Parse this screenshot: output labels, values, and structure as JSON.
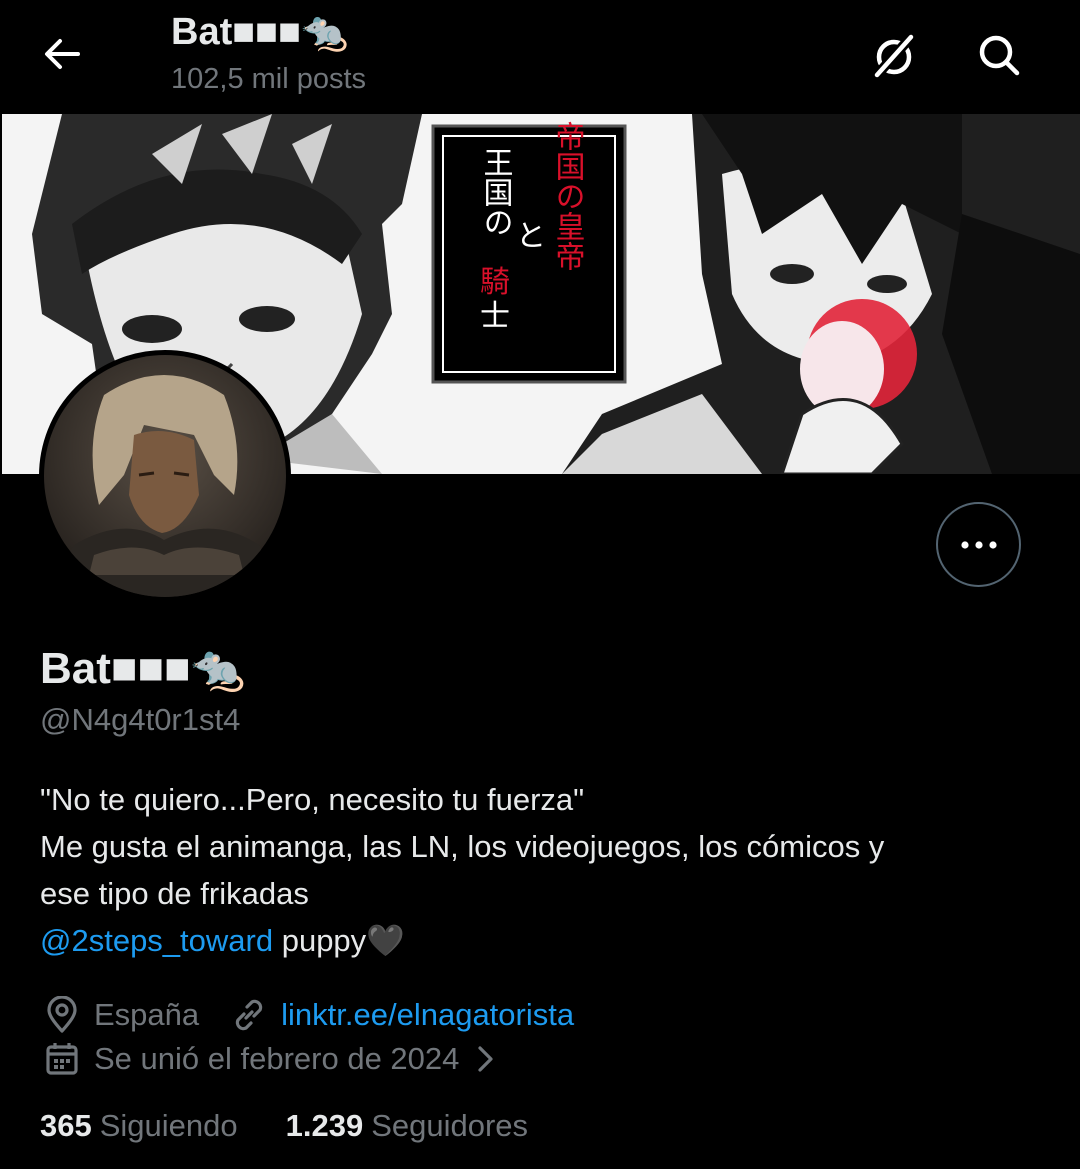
{
  "header": {
    "title": "Bat■■■🐀",
    "posts_count": "102,5 mil posts"
  },
  "banner": {
    "title_red": "帝国の皇帝",
    "conjunction": "と",
    "subtitle_prefix": "王国の",
    "subtitle_red": "騎",
    "subtitle_suffix": "士"
  },
  "profile": {
    "display_name": "Bat■■■🐀",
    "handle": "@N4g4t0r1st4",
    "bio_line1": "\"No te quiero...Pero, necesito tu fuerza\"",
    "bio_line2": "Me gusta el animanga, las LN, los videojuegos, los cómicos y",
    "bio_line3": "ese tipo de frikadas",
    "bio_mention": "@2steps_toward",
    "bio_mention_suffix": " puppy🖤",
    "location": "España",
    "website": "linktr.ee/elnagatorista",
    "joined": "Se unió el febrero de 2024",
    "following_count": "365",
    "following_label": "Siguiendo",
    "followers_count": "1.239",
    "followers_label": "Seguidores"
  },
  "icons": {
    "back": "arrow-left-icon",
    "grok": "grok-icon",
    "search": "search-icon",
    "more": "more-dots-icon",
    "location": "map-pin-icon",
    "link": "link-icon",
    "calendar": "calendar-icon",
    "chevron": "chevron-right-icon"
  },
  "colors": {
    "background": "#000000",
    "primary_text": "#e7e9ea",
    "secondary_text": "#71767b",
    "link": "#1d9bf0",
    "border": "#536471"
  }
}
